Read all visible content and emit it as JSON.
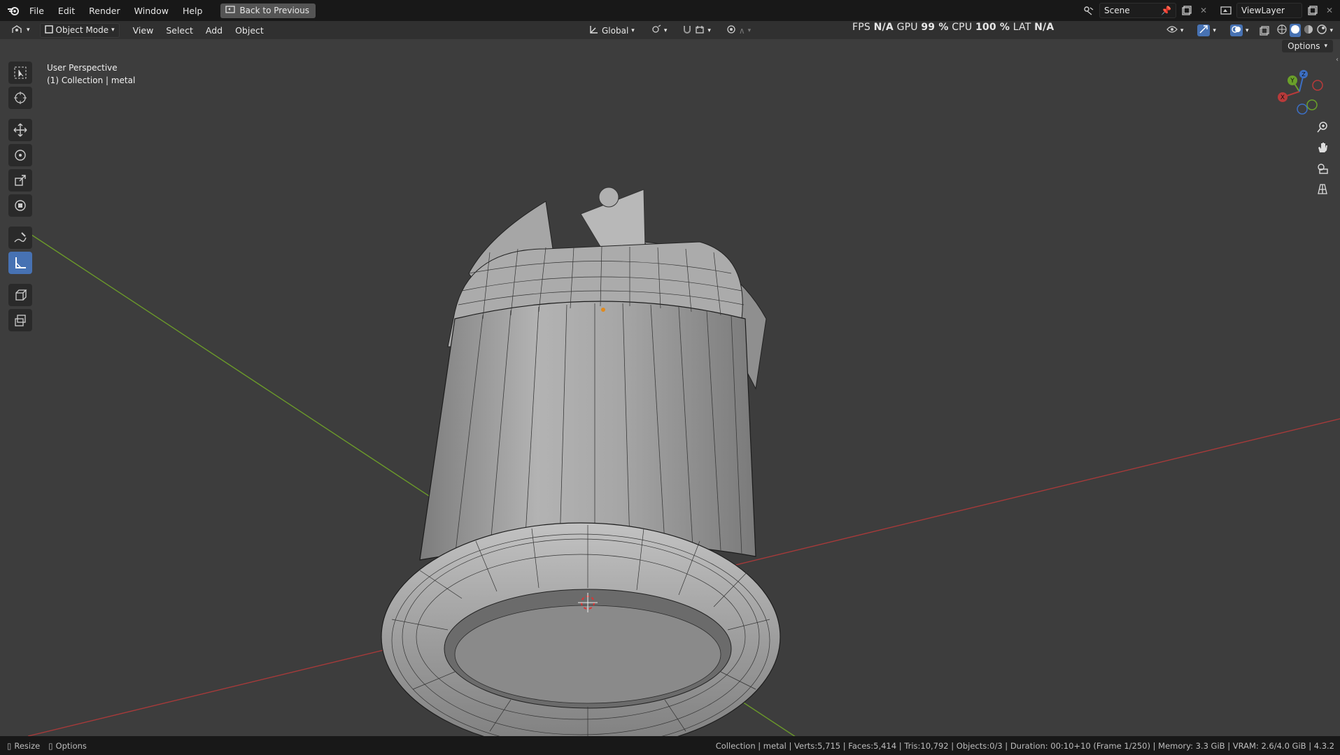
{
  "menu": {
    "items": [
      "File",
      "Edit",
      "Render",
      "Window",
      "Help"
    ],
    "back_label": "Back to Previous"
  },
  "scene": {
    "name": "Scene",
    "view_layer": "ViewLayer"
  },
  "header": {
    "mode_label": "Object Mode",
    "menus": [
      "View",
      "Select",
      "Add",
      "Object"
    ],
    "transform_orientation": "Global"
  },
  "stats": {
    "fps_label": "FPS",
    "fps_value": "N/A",
    "gpu_label": "GPU",
    "gpu_value": "99 %",
    "cpu_label": "CPU",
    "cpu_value": "100 %",
    "lat_label": "LAT",
    "lat_value": "N/A"
  },
  "viewport": {
    "perspective": "User Perspective",
    "collection": "(1) Collection | metal",
    "options_label": "Options"
  },
  "gizmo": {
    "x": "X",
    "y": "Y",
    "z": "Z"
  },
  "statusbar": {
    "resize_label": "Resize",
    "options_label": "Options",
    "info": "Collection | metal | Verts:5,715 | Faces:5,414 | Tris:10,792 | Objects:0/3 | Duration: 00:10+10 (Frame 1/250) | Memory: 3.3 GiB | VRAM: 2.6/4.0 GiB | 4.3.2"
  },
  "colors": {
    "viewport_bg": "#3d3d3d",
    "x_axis": "#a83a3a",
    "y_axis": "#6b9a2a",
    "active_tool": "#4772b3",
    "mesh_fill": "#a8a8a8"
  }
}
